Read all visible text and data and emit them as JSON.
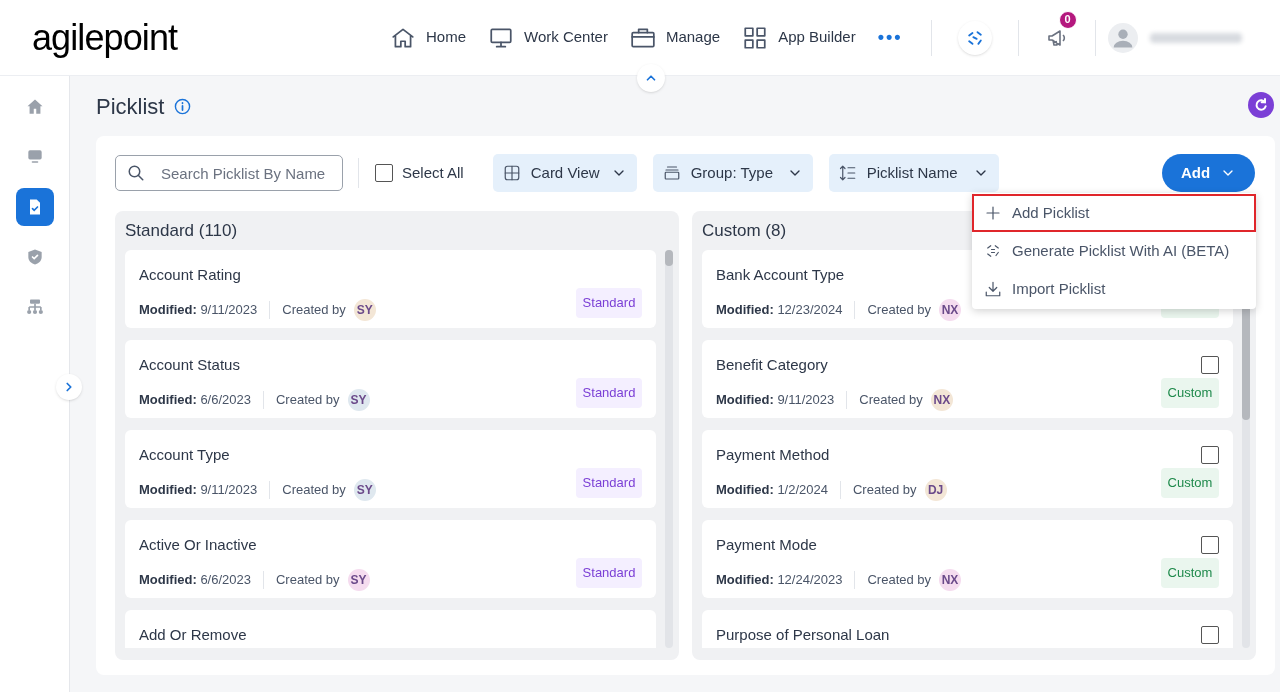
{
  "logo": "agilepoint",
  "nav": [
    {
      "label": "Home"
    },
    {
      "label": "Work Center"
    },
    {
      "label": "Manage"
    },
    {
      "label": "App Builder"
    }
  ],
  "more": "•••",
  "notifications": {
    "count": "0"
  },
  "sidebar": [
    {
      "selected": false
    },
    {
      "selected": false
    },
    {
      "selected": true
    },
    {
      "selected": false
    },
    {
      "selected": false
    }
  ],
  "page": {
    "title": "Picklist"
  },
  "toolbar": {
    "search": {
      "placeholder": "Search Picklist By Name"
    },
    "select_all": {
      "label": "Select All",
      "checked": false
    },
    "dropdowns": [
      {
        "label": "Card View"
      },
      {
        "label": "Group: Type"
      },
      {
        "label": "Picklist Name"
      }
    ],
    "add": "Add"
  },
  "add_menu": [
    {
      "label": "Add Picklist",
      "highlighted": true
    },
    {
      "label": "Generate Picklist With AI (BETA)",
      "highlighted": false
    },
    {
      "label": "Import Picklist",
      "highlighted": false
    }
  ],
  "columns": [
    {
      "title": "Standard (110)",
      "cards": [
        {
          "name": "Account Rating",
          "modified_label": "Modified:",
          "modified": "9/11/2023",
          "created_label": "Created by",
          "initials": "SY",
          "color": "#f3e6d6",
          "tag": {
            "kind": "standard",
            "label": "Standard"
          }
        },
        {
          "name": "Account Status",
          "modified_label": "Modified:",
          "modified": "6/6/2023",
          "created_label": "Created by",
          "initials": "SY",
          "color": "#dfe8ef",
          "tag": {
            "kind": "standard",
            "label": "Standard"
          }
        },
        {
          "name": "Account Type",
          "modified_label": "Modified:",
          "modified": "9/11/2023",
          "created_label": "Created by",
          "initials": "SY",
          "color": "#dfe8ef",
          "tag": {
            "kind": "standard",
            "label": "Standard"
          }
        },
        {
          "name": "Active Or Inactive",
          "modified_label": "Modified:",
          "modified": "6/6/2023",
          "created_label": "Created by",
          "initials": "SY",
          "color": "#f5dcef",
          "tag": {
            "kind": "standard",
            "label": "Standard"
          }
        },
        {
          "name": "Add Or Remove"
        }
      ]
    },
    {
      "title": "Custom (8)",
      "cards": [
        {
          "name": "Bank Account Type",
          "modified_label": "Modified:",
          "modified": "12/23/2024",
          "created_label": "Created by",
          "initials": "NX",
          "color": "#f5dcef",
          "tag": {
            "kind": "custom"
          }
        },
        {
          "name": "Benefit Category",
          "checked": false,
          "modified_label": "Modified:",
          "modified": "9/11/2023",
          "created_label": "Created by",
          "initials": "NX",
          "color": "#f3e6d6",
          "tag": {
            "kind": "custom",
            "label": "Custom"
          }
        },
        {
          "name": "Payment Method",
          "checked": false,
          "modified_label": "Modified:",
          "modified": "1/2/2024",
          "created_label": "Created by",
          "initials": "DJ",
          "color": "#f3e6d6",
          "tag": {
            "kind": "custom",
            "label": "Custom"
          }
        },
        {
          "name": "Payment Mode",
          "checked": false,
          "modified_label": "Modified:",
          "modified": "12/24/2023",
          "created_label": "Created by",
          "initials": "NX",
          "color": "#f5dcef",
          "tag": {
            "kind": "custom",
            "label": "Custom"
          }
        },
        {
          "name": "Purpose of Personal Loan",
          "checked": false
        }
      ]
    }
  ]
}
